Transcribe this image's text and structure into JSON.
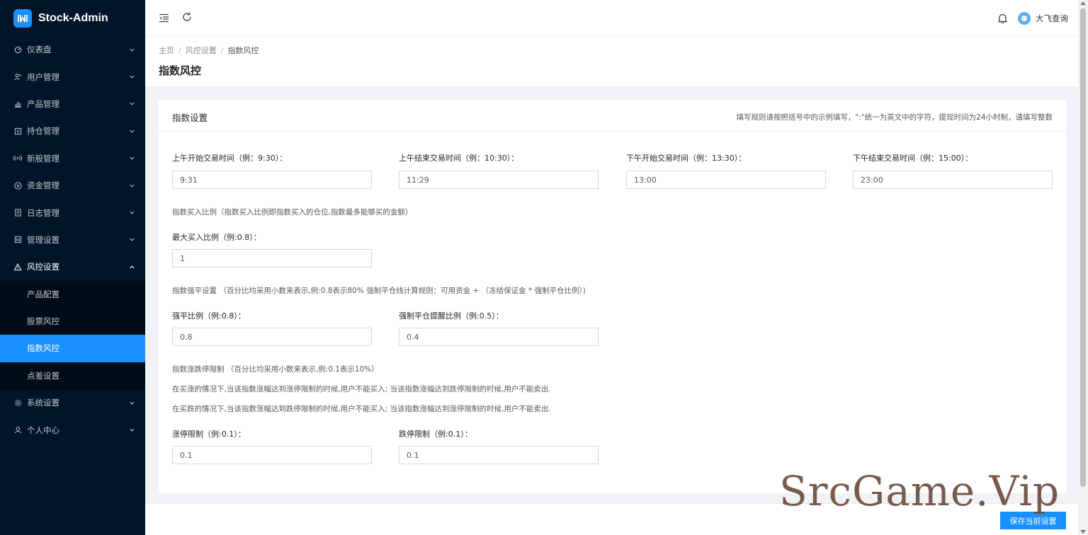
{
  "app": {
    "name": "Stock-Admin"
  },
  "sidebar": {
    "items": [
      {
        "label": "仪表盘",
        "icon": "dashboard-icon"
      },
      {
        "label": "用户管理",
        "icon": "users-icon"
      },
      {
        "label": "产品管理",
        "icon": "bar-chart-icon"
      },
      {
        "label": "持仓管理",
        "icon": "position-icon"
      },
      {
        "label": "新股管理",
        "icon": "broadcast-icon"
      },
      {
        "label": "资金管理",
        "icon": "money-icon"
      },
      {
        "label": "日志管理",
        "icon": "log-icon"
      },
      {
        "label": "管理设置",
        "icon": "settings-panel-icon"
      },
      {
        "label": "风控设置",
        "icon": "warning-icon",
        "open": true
      },
      {
        "label": "系统设置",
        "icon": "gear-icon"
      },
      {
        "label": "个人中心",
        "icon": "user-icon"
      }
    ],
    "sub_items": [
      {
        "label": "产品配置"
      },
      {
        "label": "股票风控"
      },
      {
        "label": "指数风控",
        "active": true
      },
      {
        "label": "点差设置"
      }
    ]
  },
  "header": {
    "user_name": "大飞查询"
  },
  "breadcrumb": {
    "home": "主页",
    "parent": "风控设置",
    "current": "指数风控"
  },
  "page": {
    "title": "指数风控"
  },
  "card": {
    "title": "指数设置",
    "extra": "填写规则请按照括号中的示例填写，\":\"统一为英文中的字符，提现时间为24小时制，请填写整数"
  },
  "form": {
    "am_start_label": "上午开始交易时间（例：9:30）：",
    "am_start_value": "9:31",
    "am_end_label": "上午结束交易时间（例：10:30）：",
    "am_end_value": "11:29",
    "pm_start_label": "下午开始交易时间（例：13:30）：",
    "pm_start_value": "13:00",
    "pm_end_label": "下午结束交易时间（例：15:00）：",
    "pm_end_value": "23:00",
    "buy_ratio_note": "指数买入比例（指数买入比例即指数买入的仓位,指数最多能够买的金额）",
    "max_buy_label": "最大买入比例（例:0.8）：",
    "max_buy_value": "1",
    "force_note": "指数强平设置 （百分比均采用小数来表示,例:0.8表示80% 强制平仓线计算规则：可用资金 + （冻结保证金 * 强制平仓比例）)",
    "force_ratio_label": "强平比例（例:0.8）：",
    "force_ratio_value": "0.8",
    "force_warn_label": "强制平仓提醒比例（例:0.5）：",
    "force_warn_value": "0.4",
    "limit_note": "指数涨跌停限制 （百分比均采用小数来表示,例:0.1表示10%）",
    "limit_rule_1": "在买涨的情况下,当该指数涨幅达到涨停限制的时候,用户不能买入; 当该指数涨幅达到跌停限制的时候,用户不能卖出.",
    "limit_rule_2": "在买跌的情况下,当该指数涨幅达到跌停限制的时候,用户不能买入; 当该指数涨幅达到涨停限制的时候,用户不能卖出.",
    "up_limit_label": "涨停限制（例:0.1）：",
    "up_limit_value": "0.1",
    "down_limit_label": "跌停限制（例:0.1）：",
    "down_limit_value": "0.1"
  },
  "footer": {
    "save_label": "保存当前设置"
  },
  "watermark": {
    "text": "SrcGame.Vip"
  },
  "colors": {
    "sidebar_bg": "#001529",
    "accent": "#1890ff"
  }
}
